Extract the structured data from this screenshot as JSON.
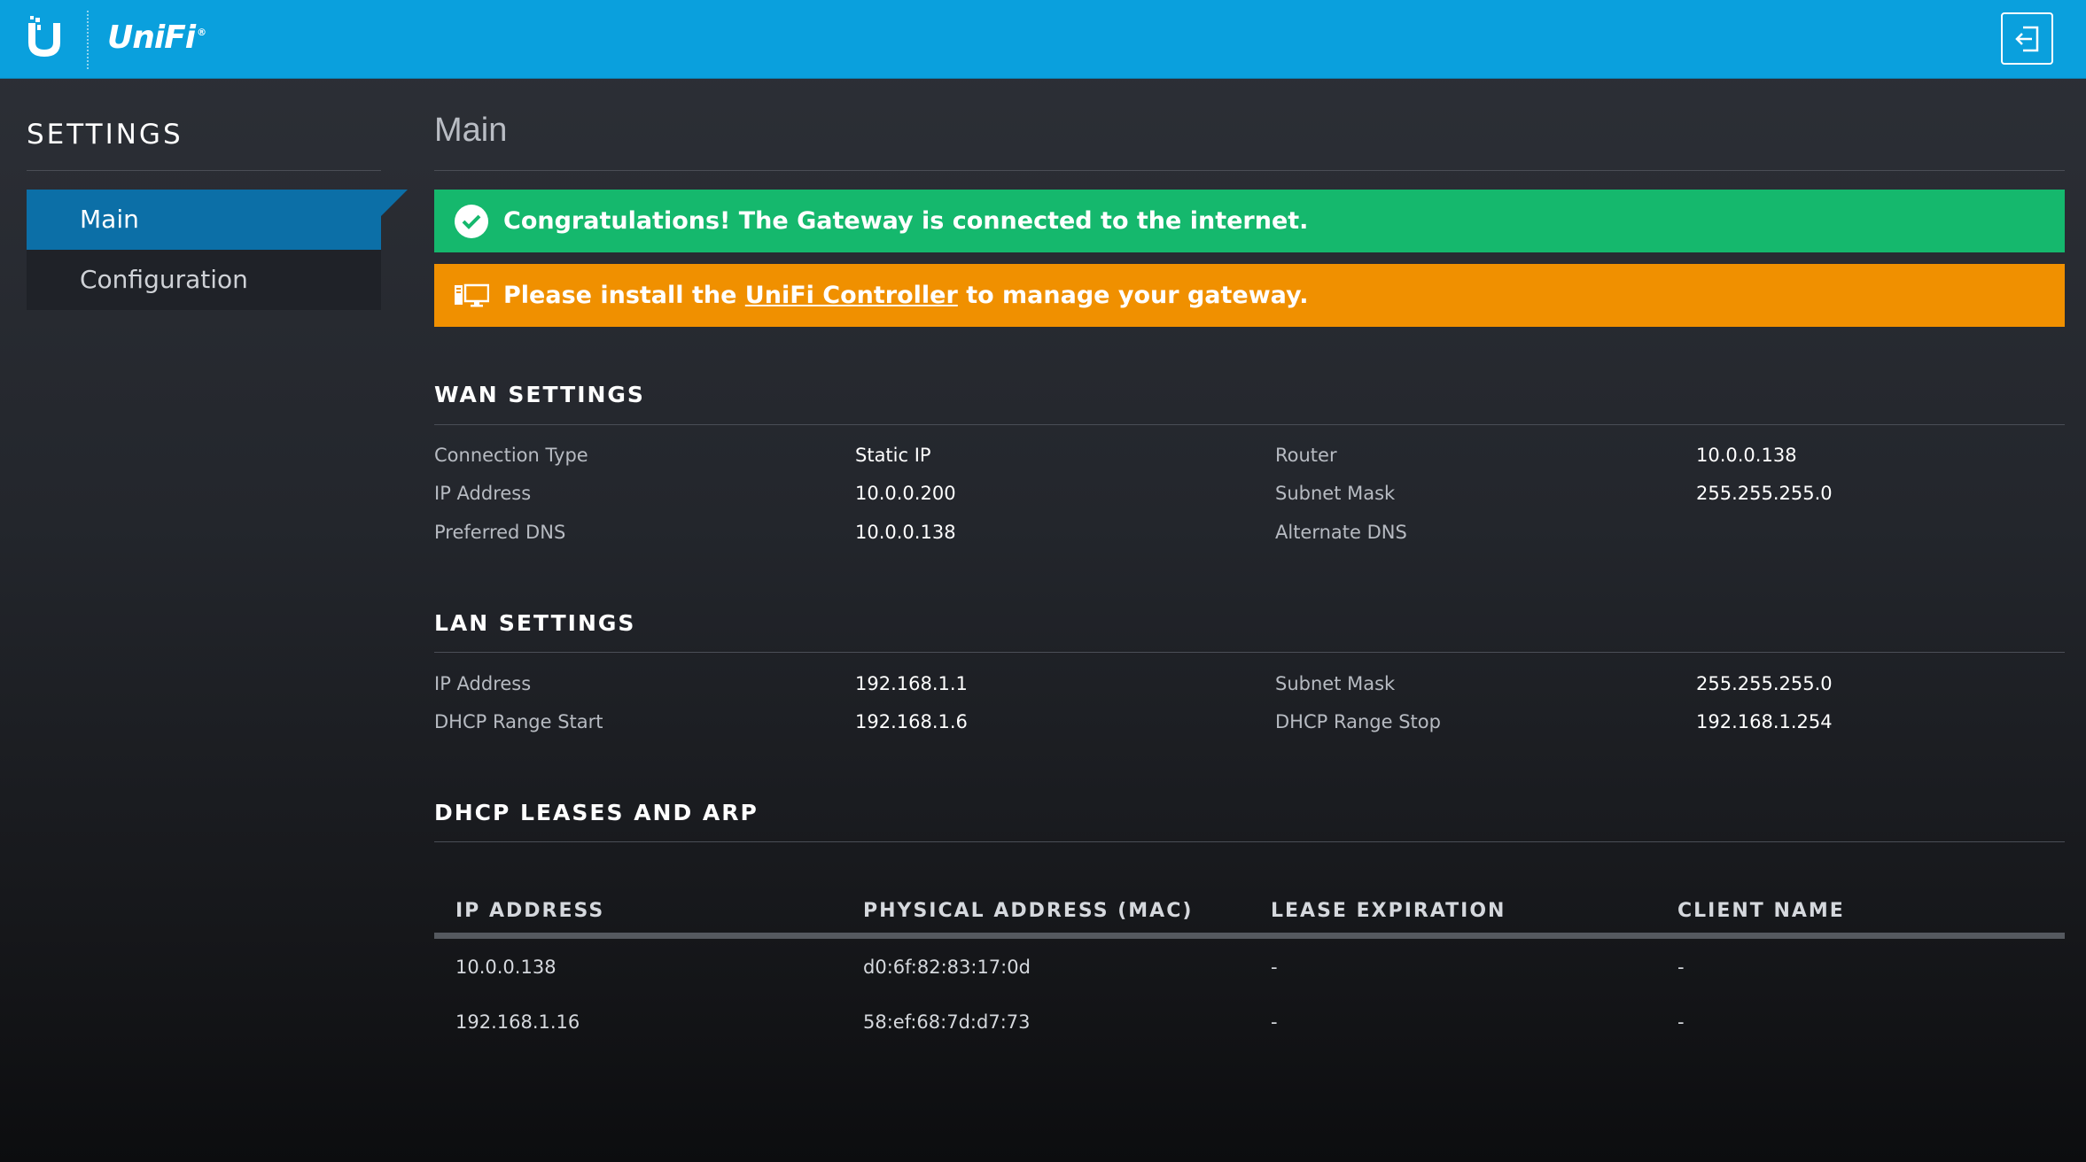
{
  "header": {
    "brand": "UniFi",
    "brand_mark": "®",
    "logout_icon": "logout-icon"
  },
  "sidebar": {
    "title": "SETTINGS",
    "items": [
      {
        "label": "Main",
        "active": true
      },
      {
        "label": "Configuration",
        "active": false
      }
    ]
  },
  "main": {
    "title": "Main",
    "alerts": {
      "success": {
        "text": "Congratulations! The Gateway is connected to the internet.",
        "color": "#15b86d",
        "icon": "check-circle-icon"
      },
      "warning": {
        "prefix": "Please install the ",
        "link": "UniFi Controller",
        "suffix": " to manage your gateway.",
        "color": "#f09000",
        "icon": "monitor-icon"
      }
    },
    "wan": {
      "title": "WAN SETTINGS",
      "connection_type_label": "Connection Type",
      "connection_type_value": "Static IP",
      "ip_label": "IP Address",
      "ip_value": "10.0.0.200",
      "pref_dns_label": "Preferred DNS",
      "pref_dns_value": "10.0.0.138",
      "router_label": "Router",
      "router_value": "10.0.0.138",
      "subnet_label": "Subnet Mask",
      "subnet_value": "255.255.255.0",
      "alt_dns_label": "Alternate DNS",
      "alt_dns_value": ""
    },
    "lan": {
      "title": "LAN SETTINGS",
      "ip_label": "IP Address",
      "ip_value": "192.168.1.1",
      "dhcp_start_label": "DHCP Range Start",
      "dhcp_start_value": "192.168.1.6",
      "subnet_label": "Subnet Mask",
      "subnet_value": "255.255.255.0",
      "dhcp_stop_label": "DHCP Range Stop",
      "dhcp_stop_value": "192.168.1.254"
    },
    "leases": {
      "title": "DHCP LEASES AND ARP",
      "columns": [
        "IP ADDRESS",
        "PHYSICAL ADDRESS (MAC)",
        "LEASE EXPIRATION",
        "CLIENT NAME"
      ],
      "rows": [
        [
          "10.0.0.138",
          "d0:6f:82:83:17:0d",
          "-",
          "-"
        ],
        [
          "192.168.1.16",
          "58:ef:68:7d:d7:73",
          "-",
          "-"
        ]
      ]
    }
  },
  "colors": {
    "topbar": "#0aa0dd",
    "active_nav": "#0c6fa7"
  }
}
